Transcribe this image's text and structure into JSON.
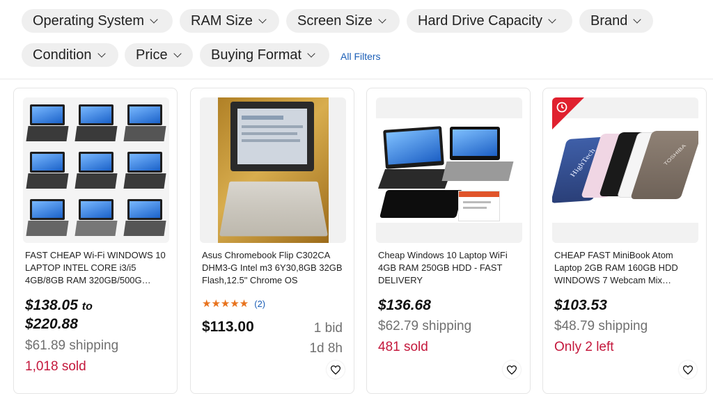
{
  "filters": {
    "chips": [
      "Operating System",
      "RAM Size",
      "Screen Size",
      "Hard Drive Capacity",
      "Brand",
      "Condition",
      "Price",
      "Buying Format"
    ],
    "all_filters": "All Filters"
  },
  "listings": [
    {
      "title": "FAST CHEAP Wi-Fi WINDOWS 10 LAPTOP INTEL CORE i3/i5 4GB/8GB RAM 320GB/500G…",
      "price_low": "$138.05",
      "price_to": "to",
      "price_high": "$220.88",
      "shipping": "$61.89 shipping",
      "sold": "1,018 sold"
    },
    {
      "title": "Asus Chromebook Flip C302CA DHM3-G Intel m3 6Y30,8GB 32GB Flash,12.5\" Chrome OS",
      "rating_count": "(2)",
      "rating_stars": 5,
      "price": "$113.00",
      "bids": "1 bid",
      "time_left": "1d 8h"
    },
    {
      "title": "Cheap Windows 10 Laptop WiFi 4GB RAM 250GB HDD - FAST DELIVERY",
      "price": "$136.68",
      "shipping": "$62.79 shipping",
      "sold": "481 sold"
    },
    {
      "title": "CHEAP FAST MiniBook Atom Laptop 2GB RAM 160GB HDD WINDOWS 7 Webcam Mix…",
      "price": "$103.53",
      "shipping": "$48.79 shipping",
      "stock": "Only 2 left",
      "image_text": "HighTech",
      "brand_text": "TOSHIBA"
    }
  ],
  "colors": {
    "sold": "#c4183c",
    "link": "#1c5fb7",
    "chip_bg": "#efefef",
    "stars": "#e8721c",
    "deal_badge": "#e0202e"
  },
  "icons": [
    "chevron-down-icon",
    "heart-icon",
    "star-icon",
    "clock-icon"
  ]
}
